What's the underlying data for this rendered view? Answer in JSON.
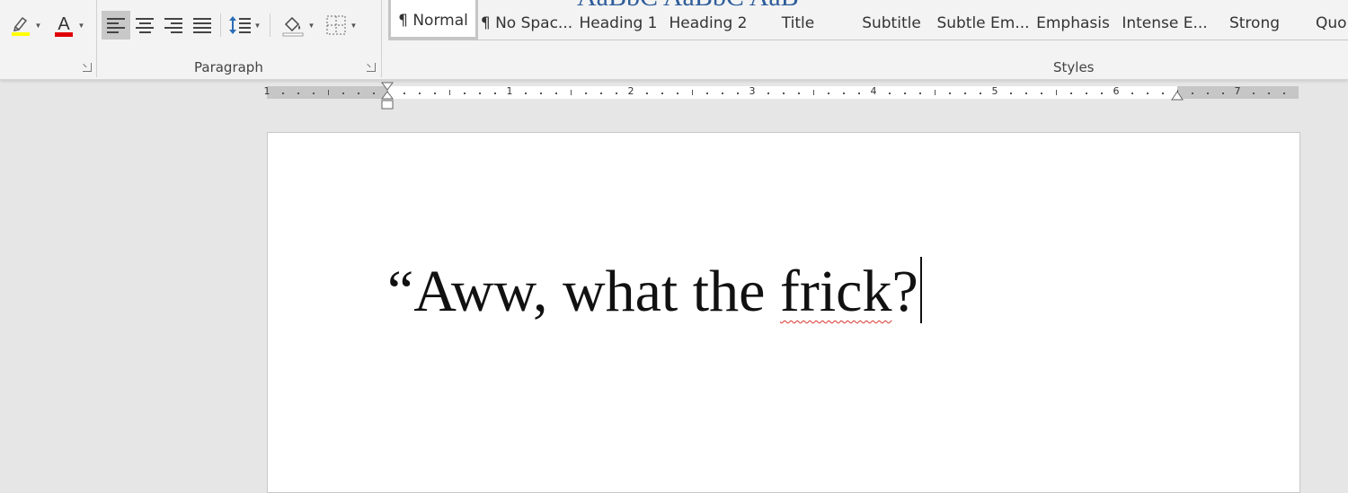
{
  "ribbon": {
    "font_group": {
      "highlight_color": "#ffff00",
      "font_color": "#e00000",
      "font_color_letter": "A"
    },
    "paragraph": {
      "label": "Paragraph",
      "buttons": [
        "align-left",
        "align-center",
        "align-right",
        "justify",
        "line-spacing",
        "shading",
        "borders"
      ],
      "active": "align-left"
    },
    "styles": {
      "label": "Styles",
      "preview_strip": "AaBbC   AaBbC   AaB",
      "items": [
        {
          "label": "¶ Normal",
          "selected": true
        },
        {
          "label": "¶ No Spac...",
          "selected": false
        },
        {
          "label": "Heading 1",
          "selected": false
        },
        {
          "label": "Heading 2",
          "selected": false
        },
        {
          "label": "Title",
          "selected": false
        },
        {
          "label": "Subtitle",
          "selected": false
        },
        {
          "label": "Subtle Em...",
          "selected": false
        },
        {
          "label": "Emphasis",
          "selected": false
        },
        {
          "label": "Intense E...",
          "selected": false
        },
        {
          "label": "Strong",
          "selected": false
        },
        {
          "label": "Quo",
          "selected": false
        }
      ]
    }
  },
  "ruler": {
    "numbers": [
      "1",
      "1",
      "2",
      "3",
      "4",
      "5",
      "6",
      "7"
    ]
  },
  "document": {
    "text_before": "“Aww, what the ",
    "misspelled_word": "frick",
    "text_after": "?"
  }
}
